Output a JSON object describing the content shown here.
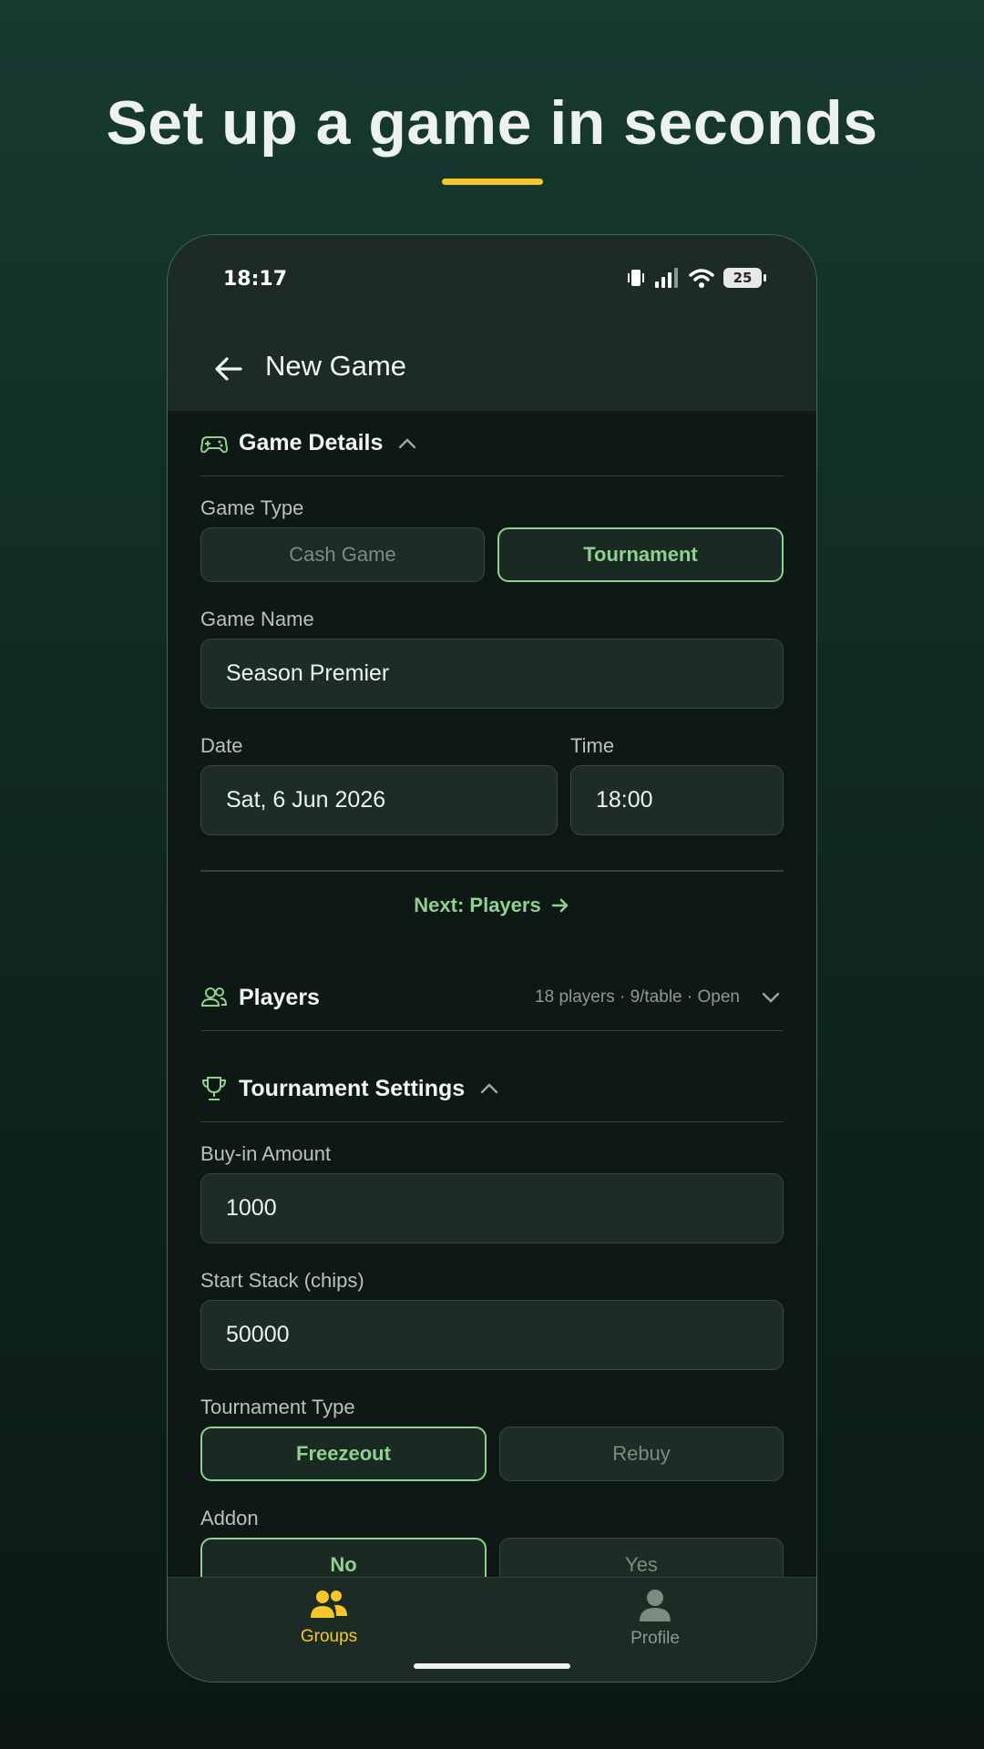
{
  "headline": "Set up a game in seconds",
  "status": {
    "time": "18:17",
    "battery": "25"
  },
  "nav": {
    "title": "New Game"
  },
  "game_details": {
    "title": "Game Details",
    "game_type_label": "Game Type",
    "game_type_options": [
      "Cash Game",
      "Tournament"
    ],
    "game_type_selected": "Tournament",
    "game_name_label": "Game Name",
    "game_name_value": "Season Premier",
    "date_label": "Date",
    "date_value": "Sat, 6 Jun 2026",
    "time_label": "Time",
    "time_value": "18:00",
    "next_label": "Next: Players"
  },
  "players": {
    "title": "Players",
    "summary": "18 players · 9/table · Open"
  },
  "tournament": {
    "title": "Tournament Settings",
    "buyin_label": "Buy-in Amount",
    "buyin_value": "1000",
    "stack_label": "Start Stack (chips)",
    "stack_value": "50000",
    "type_label": "Tournament Type",
    "type_options": [
      "Freezeout",
      "Rebuy"
    ],
    "type_selected": "Freezeout",
    "addon_label": "Addon",
    "addon_options": [
      "No",
      "Yes"
    ],
    "addon_selected": "No"
  },
  "tabbar": {
    "groups_label": "Groups",
    "profile_label": "Profile"
  },
  "colors": {
    "accent_green": "#8fd18f",
    "accent_yellow": "#f5c72a",
    "background": "#0e1915"
  }
}
